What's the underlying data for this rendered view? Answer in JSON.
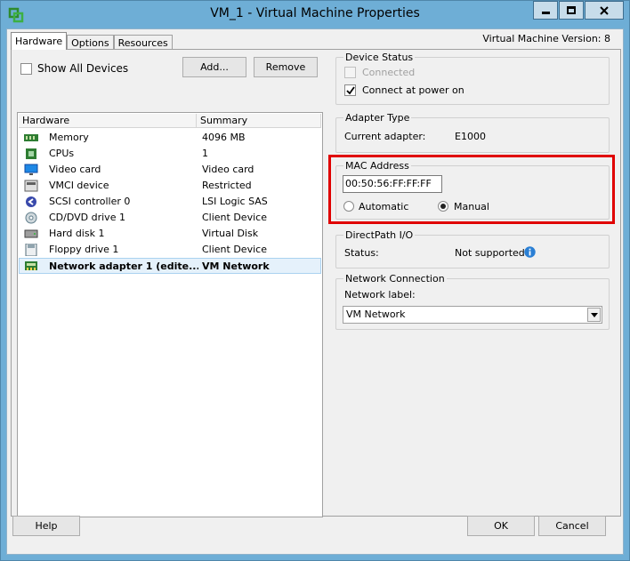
{
  "window": {
    "title": "VM_1 - Virtual Machine Properties",
    "minimize_icon": "minimize-icon",
    "maximize_icon": "maximize-icon",
    "close_icon": "close-icon"
  },
  "tabs": [
    {
      "label": "Hardware",
      "active": true
    },
    {
      "label": "Options",
      "active": false
    },
    {
      "label": "Resources",
      "active": false
    }
  ],
  "vm_version": "Virtual Machine Version: 8",
  "hardware": {
    "show_all_devices_label": "Show All Devices",
    "show_all_devices_checked": false,
    "add_label": "Add...",
    "remove_label": "Remove",
    "columns": [
      "Hardware",
      "Summary"
    ],
    "rows": [
      {
        "icon": "memory-icon",
        "name": "Memory",
        "summary": "4096 MB",
        "selected": false
      },
      {
        "icon": "cpu-icon",
        "name": "CPUs",
        "summary": "1",
        "selected": false
      },
      {
        "icon": "video-card-icon",
        "name": "Video card",
        "summary": "Video card",
        "selected": false
      },
      {
        "icon": "vmci-device-icon",
        "name": "VMCI device",
        "summary": "Restricted",
        "selected": false
      },
      {
        "icon": "scsi-controller-icon",
        "name": "SCSI controller 0",
        "summary": "LSI Logic SAS",
        "selected": false
      },
      {
        "icon": "cd-dvd-icon",
        "name": "CD/DVD drive 1",
        "summary": "Client Device",
        "selected": false
      },
      {
        "icon": "hard-disk-icon",
        "name": "Hard disk 1",
        "summary": "Virtual Disk",
        "selected": false
      },
      {
        "icon": "floppy-icon",
        "name": "Floppy drive 1",
        "summary": "Client Device",
        "selected": false
      },
      {
        "icon": "network-adapter-icon",
        "name": "Network adapter 1 (edite...",
        "summary": "VM Network",
        "selected": true
      }
    ]
  },
  "device_status": {
    "legend": "Device Status",
    "connected_label": "Connected",
    "connected_checked": false,
    "connected_disabled": true,
    "power_on_label": "Connect at power on",
    "power_on_checked": true
  },
  "adapter_type": {
    "legend": "Adapter Type",
    "current_label": "Current adapter:",
    "current_value": "E1000"
  },
  "mac_address": {
    "legend": "MAC Address",
    "value": "00:50:56:FF:FF:FF",
    "automatic_label": "Automatic",
    "manual_label": "Manual",
    "selected": "Manual",
    "highlight_color": "#e00000"
  },
  "directpath": {
    "legend": "DirectPath I/O",
    "status_label": "Status:",
    "status_value": "Not supported",
    "info_icon": "info-icon"
  },
  "network_connection": {
    "legend": "Network Connection",
    "label": "Network label:",
    "selected": "VM Network"
  },
  "footer": {
    "help_label": "Help",
    "ok_label": "OK",
    "cancel_label": "Cancel"
  }
}
